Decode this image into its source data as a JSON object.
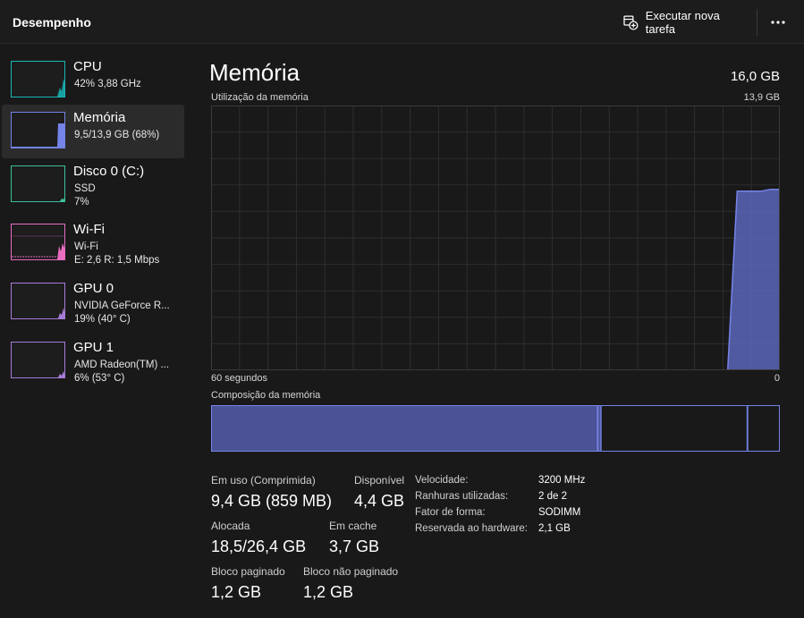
{
  "header": {
    "title": "Desempenho",
    "run_task_label": "Executar nova tarefa",
    "more_label": "•••"
  },
  "sidebar": {
    "items": [
      {
        "title": "CPU",
        "line1": "42% 3,88 GHz",
        "line2": "",
        "color": "#19b7b7",
        "selected": false
      },
      {
        "title": "Memória",
        "line1": "9,5/13,9 GB (68%)",
        "line2": "",
        "color": "#7584e8",
        "selected": true
      },
      {
        "title": "Disco 0 (C:)",
        "line1": "SSD",
        "line2": "7%",
        "color": "#3dbf9c",
        "selected": false
      },
      {
        "title": "Wi-Fi",
        "line1": "Wi-Fi",
        "line2": "E: 2,6 R: 1,5 Mbps",
        "color": "#e86cc0",
        "selected": false
      },
      {
        "title": "GPU 0",
        "line1": "NVIDIA GeForce R...",
        "line2": "19% (40° C)",
        "color": "#a77cd8",
        "selected": false
      },
      {
        "title": "GPU 1",
        "line1": "AMD Radeon(TM) ...",
        "line2": "6% (53° C)",
        "color": "#a77cd8",
        "selected": false
      }
    ]
  },
  "main": {
    "title": "Memória",
    "total": "16,0 GB",
    "usage_label": "Utilização da memória",
    "usage_max": "13,9 GB",
    "x_left": "60 segundos",
    "x_right": "0",
    "composition_label": "Composição da memória",
    "accent": "#7584e8"
  },
  "chart_data": {
    "type": "area",
    "x_range": [
      60,
      0
    ],
    "ylim": [
      0,
      13.9
    ],
    "x": [
      60,
      5.5,
      4.5,
      2,
      1,
      0
    ],
    "values": [
      0,
      0,
      9.4,
      9.4,
      9.5,
      9.5
    ]
  },
  "composition": {
    "in_use_fraction": 0.68,
    "modified_fraction": 0.005,
    "standby_fraction": 0.258,
    "free_fraction": 0.057
  },
  "stats": {
    "in_use_label": "Em uso (Comprimida)",
    "in_use_value": "9,4 GB (859 MB)",
    "available_label": "Disponível",
    "available_value": "4,4 GB",
    "committed_label": "Alocada",
    "committed_value": "18,5/26,4 GB",
    "cached_label": "Em cache",
    "cached_value": "3,7 GB",
    "paged_label": "Bloco paginado",
    "paged_value": "1,2 GB",
    "nonpaged_label": "Bloco não paginado",
    "nonpaged_value": "1,2 GB"
  },
  "details": {
    "speed_label": "Velocidade:",
    "speed_value": "3200 MHz",
    "slots_label": "Ranhuras utilizadas:",
    "slots_value": "2 de 2",
    "form_label": "Fator de forma:",
    "form_value": "SODIMM",
    "reserved_label": "Reservada ao hardware:",
    "reserved_value": "2,1 GB"
  }
}
